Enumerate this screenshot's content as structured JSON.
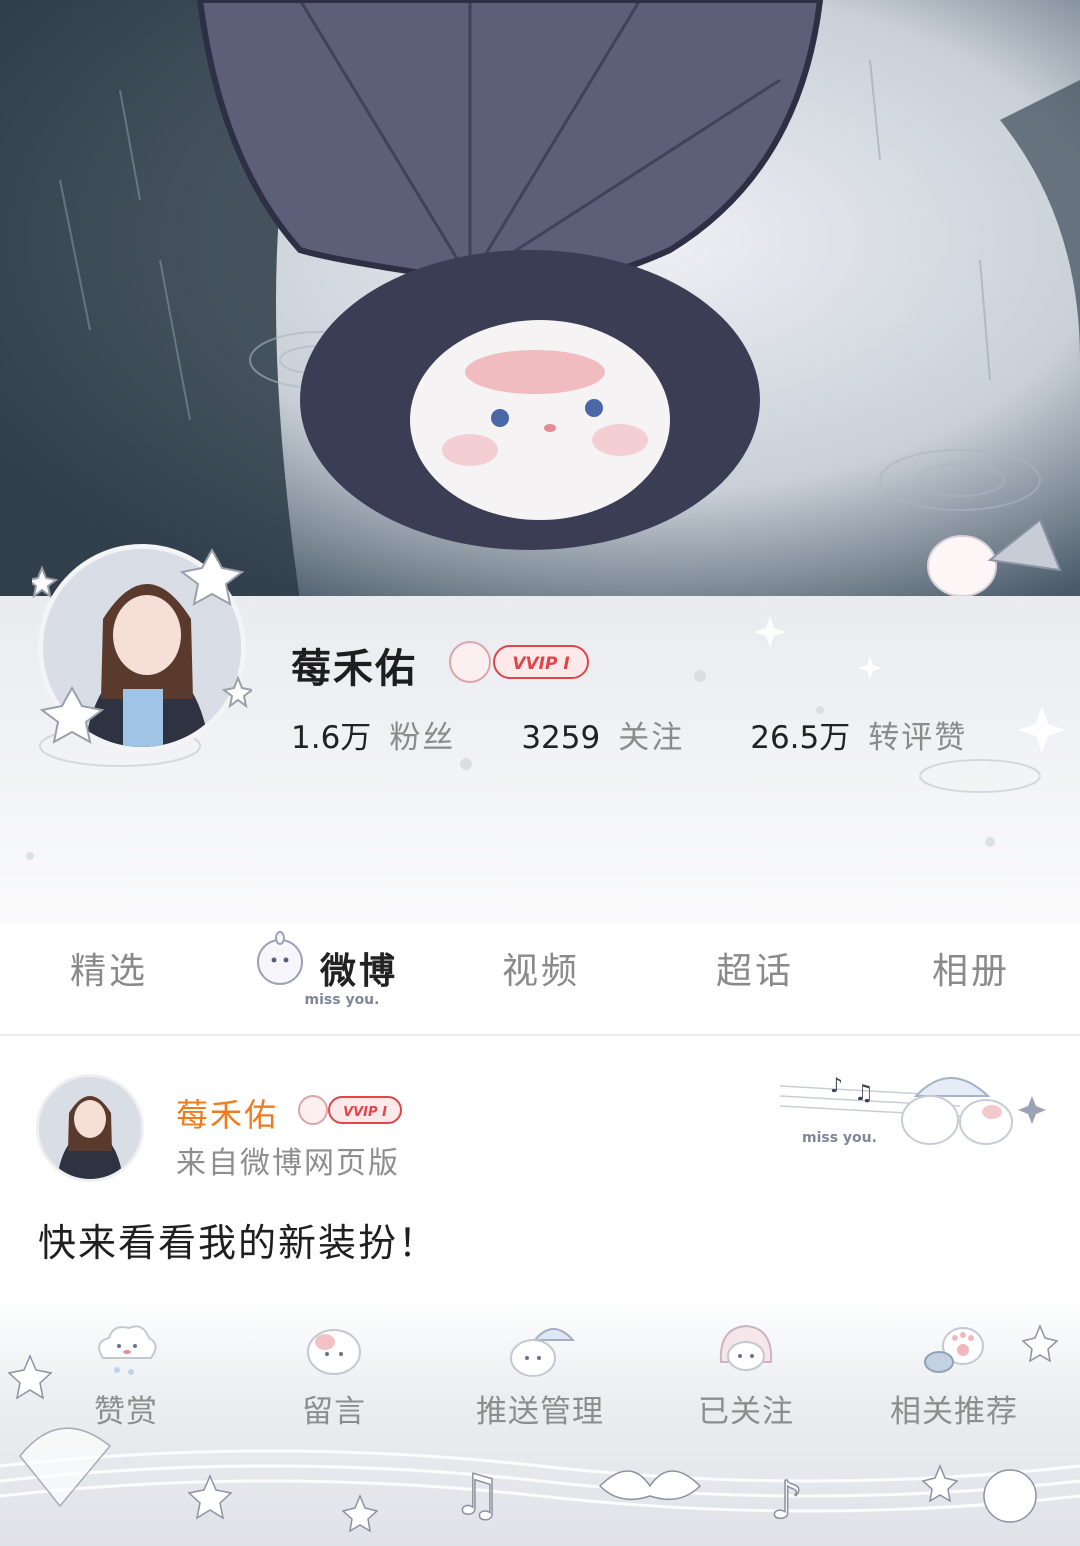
{
  "profile": {
    "name": "莓禾佑",
    "vip_badge": "VVIP Ⅰ",
    "stats": [
      {
        "value": "1.6万",
        "label": "粉丝"
      },
      {
        "value": "3259",
        "label": "关注"
      },
      {
        "value": "26.5万",
        "label": "转评赞"
      }
    ]
  },
  "tabs": [
    {
      "label": "精选",
      "active": false
    },
    {
      "label": "微博",
      "active": true
    },
    {
      "label": "视频",
      "active": false
    },
    {
      "label": "超话",
      "active": false
    },
    {
      "label": "相册",
      "active": false
    }
  ],
  "tab_decoration_text": "miss you.",
  "post": {
    "author": "莓禾佑",
    "vip_badge": "VVIP Ⅰ",
    "source": "来自微博网页版",
    "text": "快来看看我的新装扮！",
    "card_decoration_text": "miss you."
  },
  "bottom_bar": [
    {
      "label": "赞赏",
      "icon": "cloud-mascot-icon"
    },
    {
      "label": "留言",
      "icon": "cat-mascot-icon"
    },
    {
      "label": "推送管理",
      "icon": "umbrella-mascot-icon"
    },
    {
      "label": "已关注",
      "icon": "hooded-mascot-icon"
    },
    {
      "label": "相关推荐",
      "icon": "paw-mascot-icon"
    }
  ],
  "colors": {
    "name_orange": "#f07b1f",
    "muted_text": "#8b8b8b",
    "vip_red": "#e0454a"
  }
}
